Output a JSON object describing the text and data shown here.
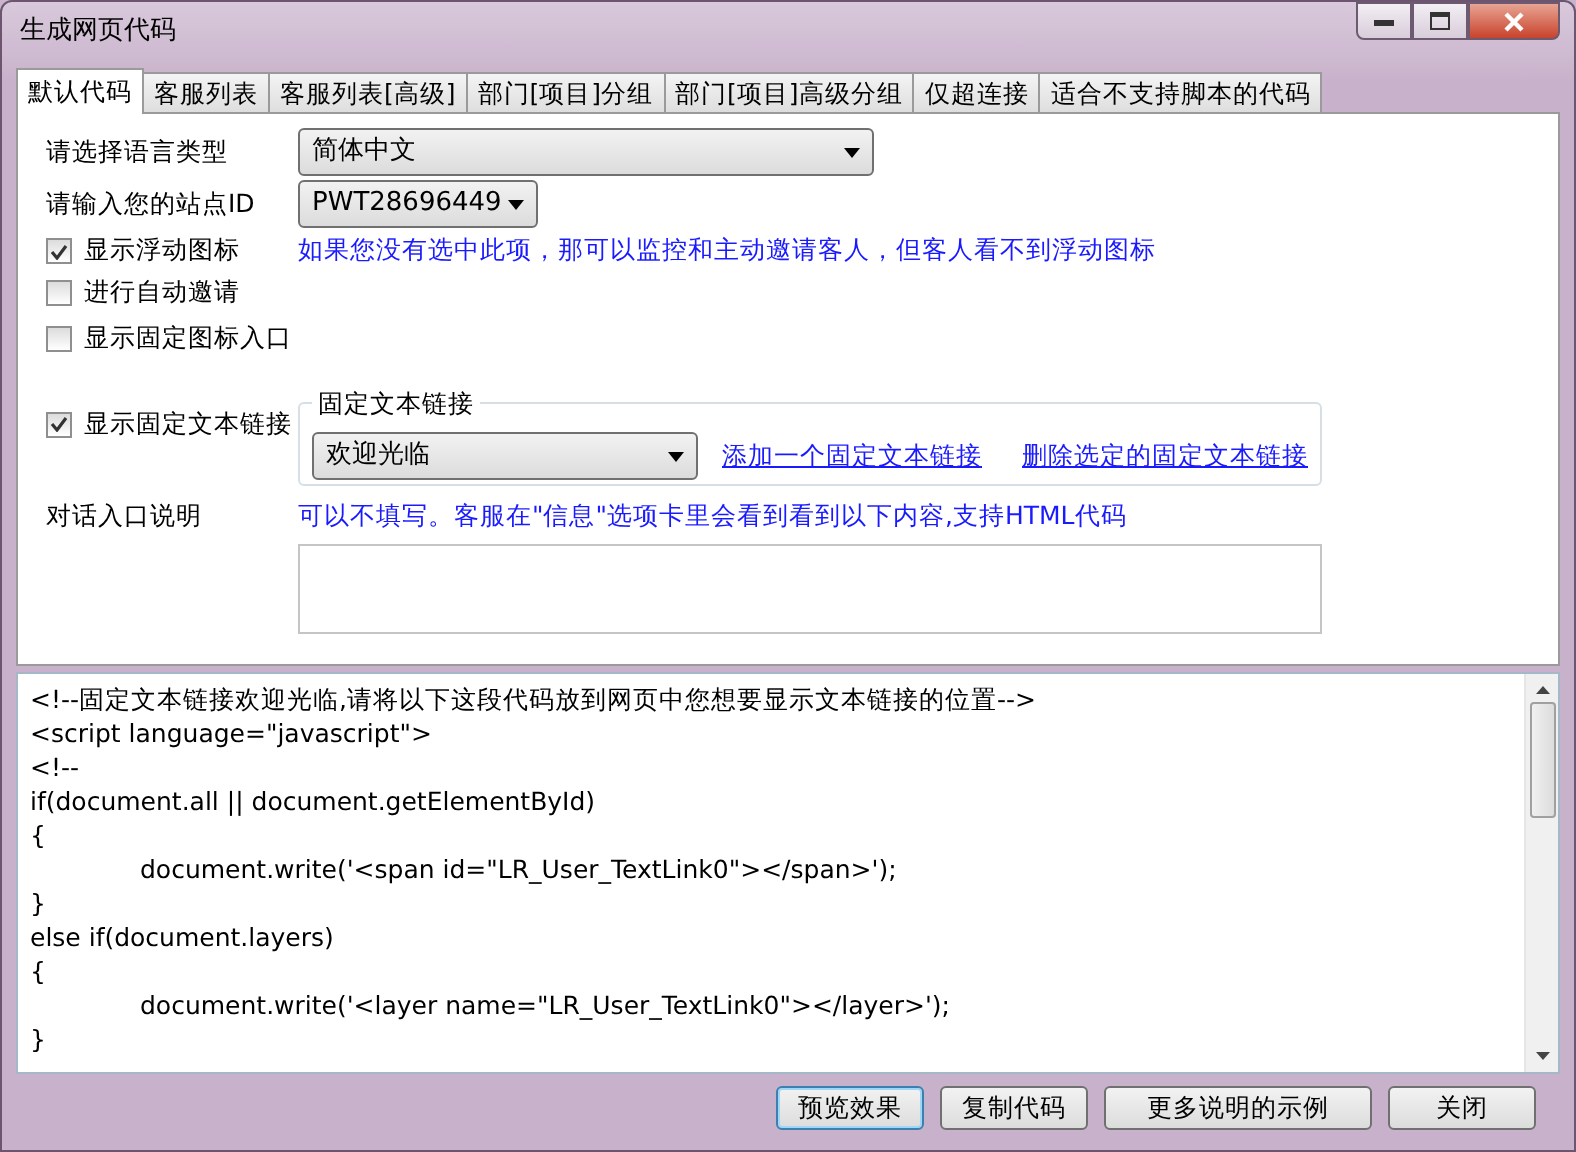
{
  "window": {
    "title": "生成网页代码"
  },
  "tabs": [
    {
      "label": "默认代码",
      "selected": true
    },
    {
      "label": "客服列表",
      "selected": false
    },
    {
      "label": "客服列表[高级]",
      "selected": false
    },
    {
      "label": "部门[项目]分组",
      "selected": false
    },
    {
      "label": "部门[项目]高级分组",
      "selected": false
    },
    {
      "label": "仅超连接",
      "selected": false
    },
    {
      "label": "适合不支持脚本的代码",
      "selected": false
    }
  ],
  "language": {
    "label": "请选择语言类型",
    "value": "简体中文"
  },
  "site_id": {
    "label": "请输入您的站点ID",
    "value": "PWT28696449"
  },
  "options": [
    {
      "label": "显示浮动图标",
      "checked": true,
      "hint": "如果您没有选中此项，那可以监控和主动邀请客人，但客人看不到浮动图标"
    },
    {
      "label": "进行自动邀请",
      "checked": false
    },
    {
      "label": "显示固定图标入口",
      "checked": false
    }
  ],
  "text_link": {
    "label": "显示固定文本链接",
    "checked": true,
    "group_title": "固定文本链接",
    "value": "欢迎光临",
    "add_link": "添加一个固定文本链接",
    "delete_link": "删除选定的固定文本链接"
  },
  "dialog_note": {
    "label": "对话入口说明",
    "hint": "可以不填写。客服在\"信息\"选项卡里会看到看到以下内容,支持HTML代码"
  },
  "code_lines": [
    {
      "text": "<!--固定文本链接欢迎光临,请将以下这段代码放到网页中您想要显示文本链接的位置-->",
      "indented": false
    },
    {
      "text": "<script language=\"javascript\">",
      "indented": false
    },
    {
      "text": "<!--",
      "indented": false
    },
    {
      "text": "if(document.all || document.getElementById)",
      "indented": false
    },
    {
      "text": "{",
      "indented": false
    },
    {
      "text": "document.write('<span id=\"LR_User_TextLink0\"></span>');",
      "indented": true
    },
    {
      "text": "}",
      "indented": false
    },
    {
      "text": "else if(document.layers)",
      "indented": false
    },
    {
      "text": "{",
      "indented": false
    },
    {
      "text": "document.write('<layer name=\"LR_User_TextLink0\"></layer>');",
      "indented": true
    },
    {
      "text": "}",
      "indented": false
    }
  ],
  "buttons": [
    {
      "label": "预览效果",
      "selected": true
    },
    {
      "label": "复制代码",
      "selected": false
    },
    {
      "label": "更多说明的示例",
      "selected": false
    },
    {
      "label": "关闭",
      "selected": false
    }
  ]
}
